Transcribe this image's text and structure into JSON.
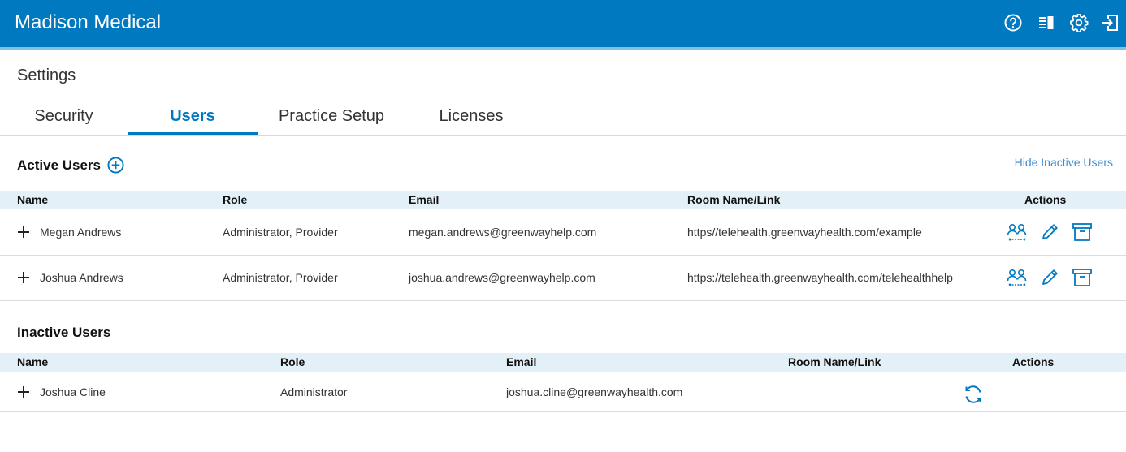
{
  "app": {
    "title": "Madison Medical"
  },
  "header_icons": [
    "help-icon",
    "book-icon",
    "gear-icon",
    "sign-out-icon"
  ],
  "page": {
    "title": "Settings"
  },
  "tabs": [
    {
      "label": "Security",
      "active": false
    },
    {
      "label": "Users",
      "active": true
    },
    {
      "label": "Practice Setup",
      "active": false
    },
    {
      "label": "Licenses",
      "active": false
    }
  ],
  "active_users": {
    "title": "Active Users",
    "hide_link": "Hide Inactive Users",
    "columns": [
      "Name",
      "Role",
      "Email",
      "Room Name/Link",
      "Actions"
    ],
    "rows": [
      {
        "name": "Megan Andrews",
        "role": "Administrator, Provider",
        "email": "megan.andrews@greenwayhelp.com",
        "room": "https//telehealth.greenwayhealth.com/example"
      },
      {
        "name": "Joshua Andrews",
        "role": "Administrator, Provider",
        "email": "joshua.andrews@greenwayhelp.com",
        "room": "https://telehealth.greenwayhealth.com/telehealthhelp"
      }
    ]
  },
  "inactive_users": {
    "title": "Inactive Users",
    "columns": [
      "Name",
      "Role",
      "Email",
      "Room Name/Link",
      "Actions"
    ],
    "rows": [
      {
        "name": "Joshua Cline",
        "role": "Administrator",
        "email": "joshua.cline@greenwayhealth.com",
        "room": ""
      }
    ]
  },
  "colors": {
    "brand": "#0079c1",
    "header_row": "#e3f0f8",
    "link": "#3a8cd0"
  }
}
